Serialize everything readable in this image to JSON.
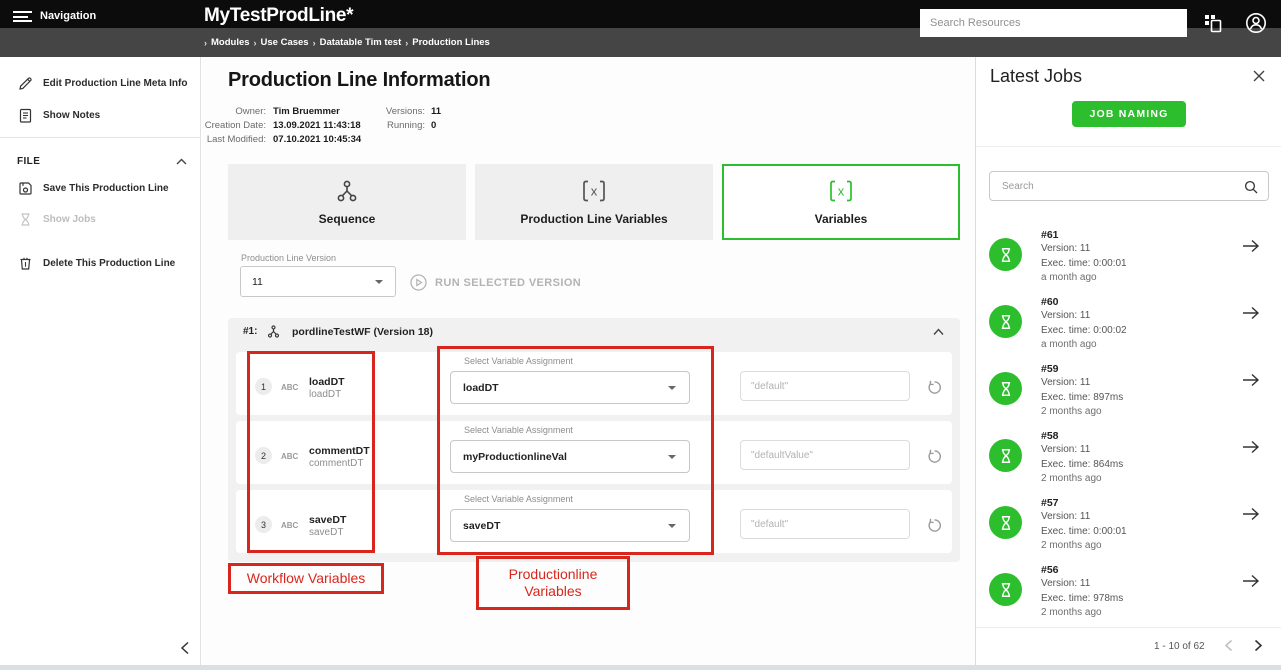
{
  "header": {
    "nav_label": "Navigation",
    "title": "MyTestProdLine*",
    "breadcrumbs": [
      "Modules",
      "Use Cases",
      "Datatable Tim test",
      "Production Lines"
    ],
    "search_placeholder": "Search Resources"
  },
  "sidebar": {
    "edit_meta": "Edit Production Line Meta Info",
    "show_notes": "Show Notes",
    "file_section": "FILE",
    "save_line": "Save This Production Line",
    "show_jobs": "Show Jobs",
    "delete_line": "Delete This Production Line"
  },
  "main": {
    "title": "Production Line Information",
    "meta": {
      "owner_label": "Owner:",
      "owner": "Tim Bruemmer",
      "creation_label": "Creation Date:",
      "creation": "13.09.2021 11:43:18",
      "modified_label": "Last Modified:",
      "modified": "07.10.2021 10:45:34",
      "versions_label": "Versions:",
      "versions": "11",
      "running_label": "Running:",
      "running": "0"
    },
    "tabs": [
      {
        "label": "Sequence"
      },
      {
        "label": "Production Line Variables"
      },
      {
        "label": "Variables"
      }
    ],
    "version_select": {
      "label": "Production Line Version",
      "value": "11"
    },
    "run_button": "RUN SELECTED VERSION",
    "workflow": {
      "index": "#1:",
      "name": "pordlineTestWF (Version 18)",
      "assign_label": "Select Variable Assignment",
      "rows": [
        {
          "num": "1",
          "type": "ABC",
          "name": "loadDT",
          "subname": "loadDT",
          "assign_value": "loadDT",
          "default_placeholder": "\"default\""
        },
        {
          "num": "2",
          "type": "ABC",
          "name": "commentDT",
          "subname": "commentDT",
          "assign_value": "myProductionlineVal",
          "default_placeholder": "\"defaultValue\""
        },
        {
          "num": "3",
          "type": "ABC",
          "name": "saveDT",
          "subname": "saveDT",
          "assign_value": "saveDT",
          "default_placeholder": "\"default\""
        }
      ]
    },
    "annotations": {
      "workflow_label": "Workflow Variables",
      "productionline_label": "Productionline Variables",
      "color": "#d9261c"
    }
  },
  "jobs_panel": {
    "title": "Latest Jobs",
    "naming_button": "JOB NAMING",
    "search_placeholder": "Search",
    "jobs": [
      {
        "id": "#61",
        "version": "Version: 11",
        "exec": "Exec. time: 0:00:01",
        "age": "a month ago"
      },
      {
        "id": "#60",
        "version": "Version: 11",
        "exec": "Exec. time: 0:00:02",
        "age": "a month ago"
      },
      {
        "id": "#59",
        "version": "Version: 11",
        "exec": "Exec. time: 897ms",
        "age": "2 months ago"
      },
      {
        "id": "#58",
        "version": "Version: 11",
        "exec": "Exec. time: 864ms",
        "age": "2 months ago"
      },
      {
        "id": "#57",
        "version": "Version: 11",
        "exec": "Exec. time: 0:00:01",
        "age": "2 months ago"
      },
      {
        "id": "#56",
        "version": "Version: 11",
        "exec": "Exec. time: 978ms",
        "age": "2 months ago"
      }
    ],
    "pagination": "1 - 10 of 62"
  },
  "colors": {
    "accent_green": "#2dbe2d",
    "annotation_red": "#d9261c"
  }
}
